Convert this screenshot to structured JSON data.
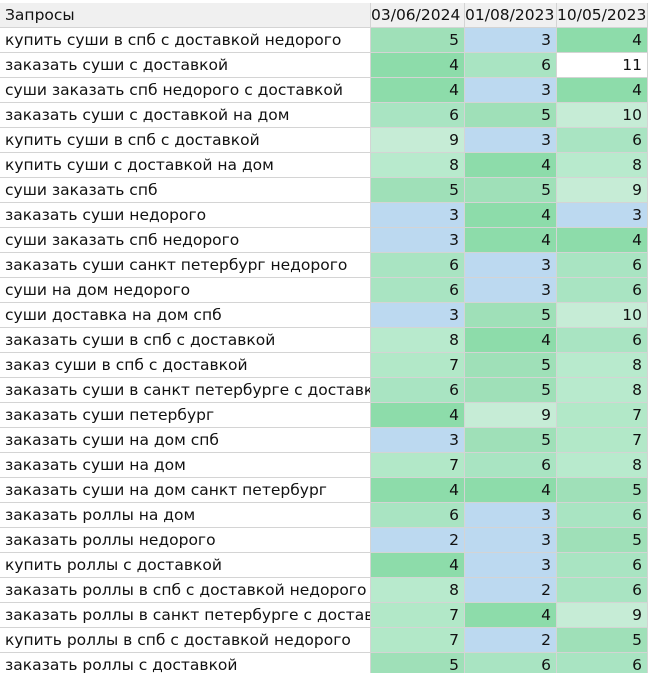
{
  "header": {
    "query_col": "Запросы",
    "dates": [
      "03/06/2024",
      "01/08/2023",
      "10/05/2023"
    ]
  },
  "color_scale": {
    "low": "#bcd9f0",
    "mid": "#c6ecd6",
    "high": "#8ddcaa",
    "very_high": "#ffffff"
  },
  "rows": [
    {
      "q": "купить суши в спб с доставкой недорого",
      "v": [
        "5",
        "3",
        "4"
      ]
    },
    {
      "q": "заказать суши с доставкой",
      "v": [
        "4",
        "6",
        "11"
      ]
    },
    {
      "q": "суши заказать спб недорого с доставкой",
      "v": [
        "4",
        "3",
        "4"
      ]
    },
    {
      "q": "заказать суши с доставкой на дом",
      "v": [
        "6",
        "5",
        "10"
      ]
    },
    {
      "q": "купить суши в спб с доставкой",
      "v": [
        "9",
        "3",
        "6"
      ]
    },
    {
      "q": "купить суши с доставкой на дом",
      "v": [
        "8",
        "4",
        "8"
      ]
    },
    {
      "q": "суши заказать спб",
      "v": [
        "5",
        "5",
        "9"
      ]
    },
    {
      "q": "заказать суши недорого",
      "v": [
        "3",
        "4",
        "3"
      ]
    },
    {
      "q": "суши заказать спб недорого",
      "v": [
        "3",
        "4",
        "4"
      ]
    },
    {
      "q": "заказать суши санкт петербург недорого",
      "v": [
        "6",
        "3",
        "6"
      ]
    },
    {
      "q": "суши на дом недорого",
      "v": [
        "6",
        "3",
        "6"
      ]
    },
    {
      "q": "суши доставка на дом спб",
      "v": [
        "3",
        "5",
        "10"
      ]
    },
    {
      "q": "заказать суши в спб с доставкой",
      "v": [
        "8",
        "4",
        "6"
      ]
    },
    {
      "q": "заказ суши в спб с доставкой",
      "v": [
        "7",
        "5",
        "8"
      ]
    },
    {
      "q": "заказать суши в санкт петербурге с доставкой",
      "v": [
        "6",
        "5",
        "8"
      ]
    },
    {
      "q": "заказать суши петербург",
      "v": [
        "4",
        "9",
        "7"
      ]
    },
    {
      "q": "заказать суши на дом спб",
      "v": [
        "3",
        "5",
        "7"
      ]
    },
    {
      "q": "заказать суши на дом",
      "v": [
        "7",
        "6",
        "8"
      ]
    },
    {
      "q": "заказать суши на дом санкт петербург",
      "v": [
        "4",
        "4",
        "5"
      ]
    },
    {
      "q": "заказать роллы на дом",
      "v": [
        "6",
        "3",
        "6"
      ]
    },
    {
      "q": "заказать роллы недорого",
      "v": [
        "2",
        "3",
        "5"
      ]
    },
    {
      "q": "купить роллы с доставкой",
      "v": [
        "4",
        "3",
        "6"
      ]
    },
    {
      "q": "заказать роллы в спб с доставкой недорого",
      "v": [
        "8",
        "2",
        "6"
      ]
    },
    {
      "q": "заказать роллы в санкт петербурге с доставкой",
      "v": [
        "7",
        "4",
        "9"
      ]
    },
    {
      "q": "купить роллы в спб с доставкой недорого",
      "v": [
        "7",
        "2",
        "5"
      ]
    },
    {
      "q": "заказать роллы с доставкой",
      "v": [
        "5",
        "6",
        "6"
      ]
    }
  ]
}
